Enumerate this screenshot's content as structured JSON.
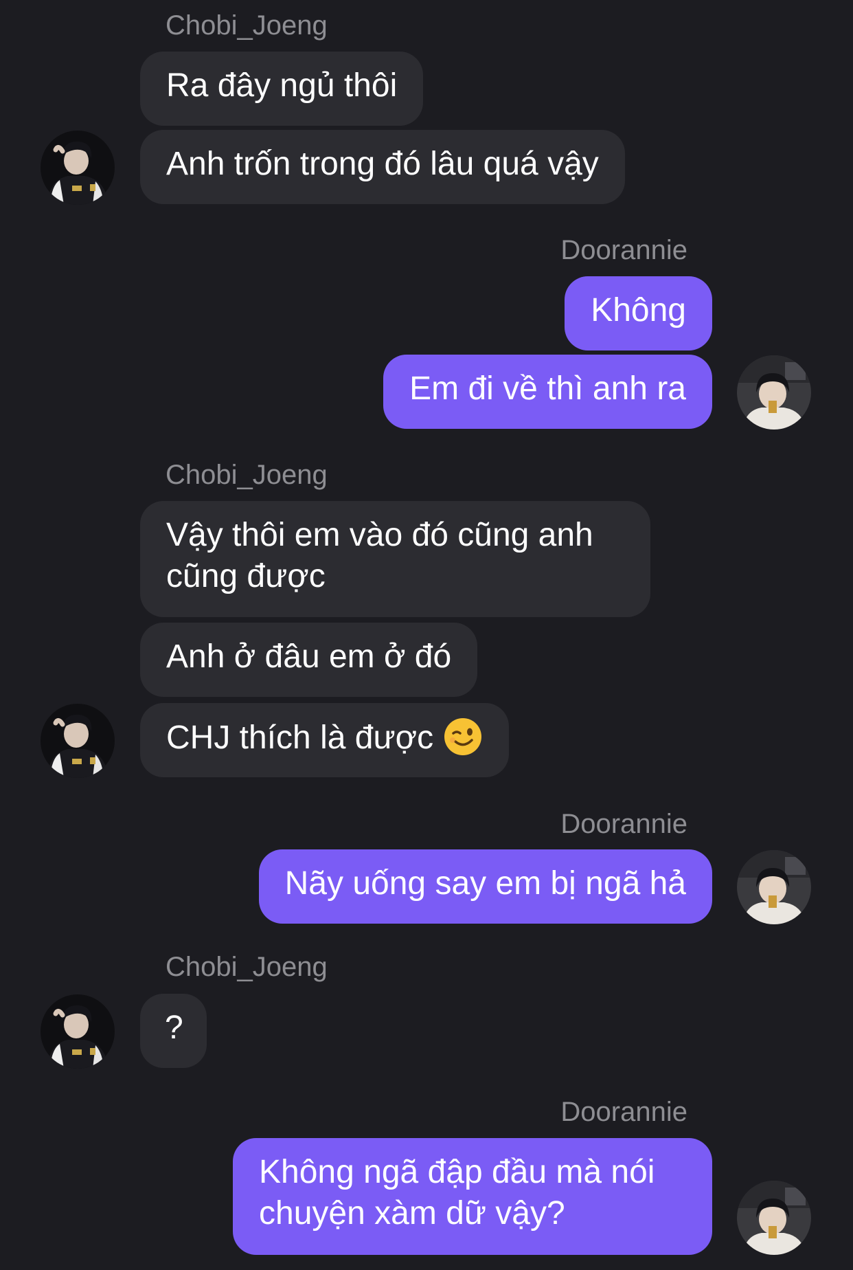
{
  "participants": {
    "other": "Chobi_Joeng",
    "me": "Doorannie"
  },
  "messages": {
    "g1_name": "Chobi_Joeng",
    "g1_m1": "Ra đây ngủ thôi",
    "g1_m2": "Anh trốn trong đó lâu quá vậy",
    "g2_name": "Doorannie",
    "g2_m1": "Không",
    "g2_m2": "Em đi về thì anh ra",
    "g3_name": "Chobi_Joeng",
    "g3_m1": "Vậy thôi em vào đó cũng anh cũng được",
    "g3_m2": "Anh ở đâu em ở đó",
    "g3_m3": "CHJ thích là được",
    "g3_m3_emoji": "winking-face-emoji",
    "g4_name": "Doorannie",
    "g4_m1": "Nãy uống say em bị ngã hả",
    "g5_name": "Chobi_Joeng",
    "g5_m1": "?",
    "g6_name": "Doorannie",
    "g6_m1": "Không ngã đập đầu mà nói chuyện xàm dữ vậy?"
  },
  "colors": {
    "background": "#1c1c21",
    "incoming_bubble": "#2c2c31",
    "outgoing_bubble": "#7b5cf5",
    "name_text": "#8e8e93"
  }
}
